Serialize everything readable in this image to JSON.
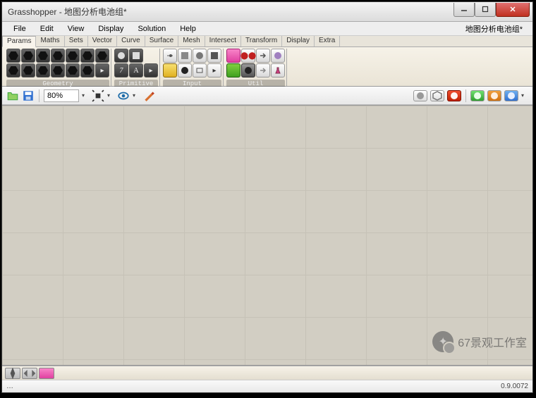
{
  "title": "Grasshopper - 地图分析电池组*",
  "doc_label": "地图分析电池组*",
  "menu": [
    "File",
    "Edit",
    "View",
    "Display",
    "Solution",
    "Help"
  ],
  "tabs": [
    "Params",
    "Maths",
    "Sets",
    "Vector",
    "Curve",
    "Surface",
    "Mesh",
    "Intersect",
    "Transform",
    "Display",
    "Extra"
  ],
  "active_tab": 0,
  "groups": {
    "geometry": "Geometry",
    "primitive": "Primitive",
    "input": "Input",
    "util": "Util"
  },
  "toolbar": {
    "zoom": "80%"
  },
  "status": {
    "version": "0.9.0072",
    "left": "…"
  },
  "watermark": "67景观工作室"
}
